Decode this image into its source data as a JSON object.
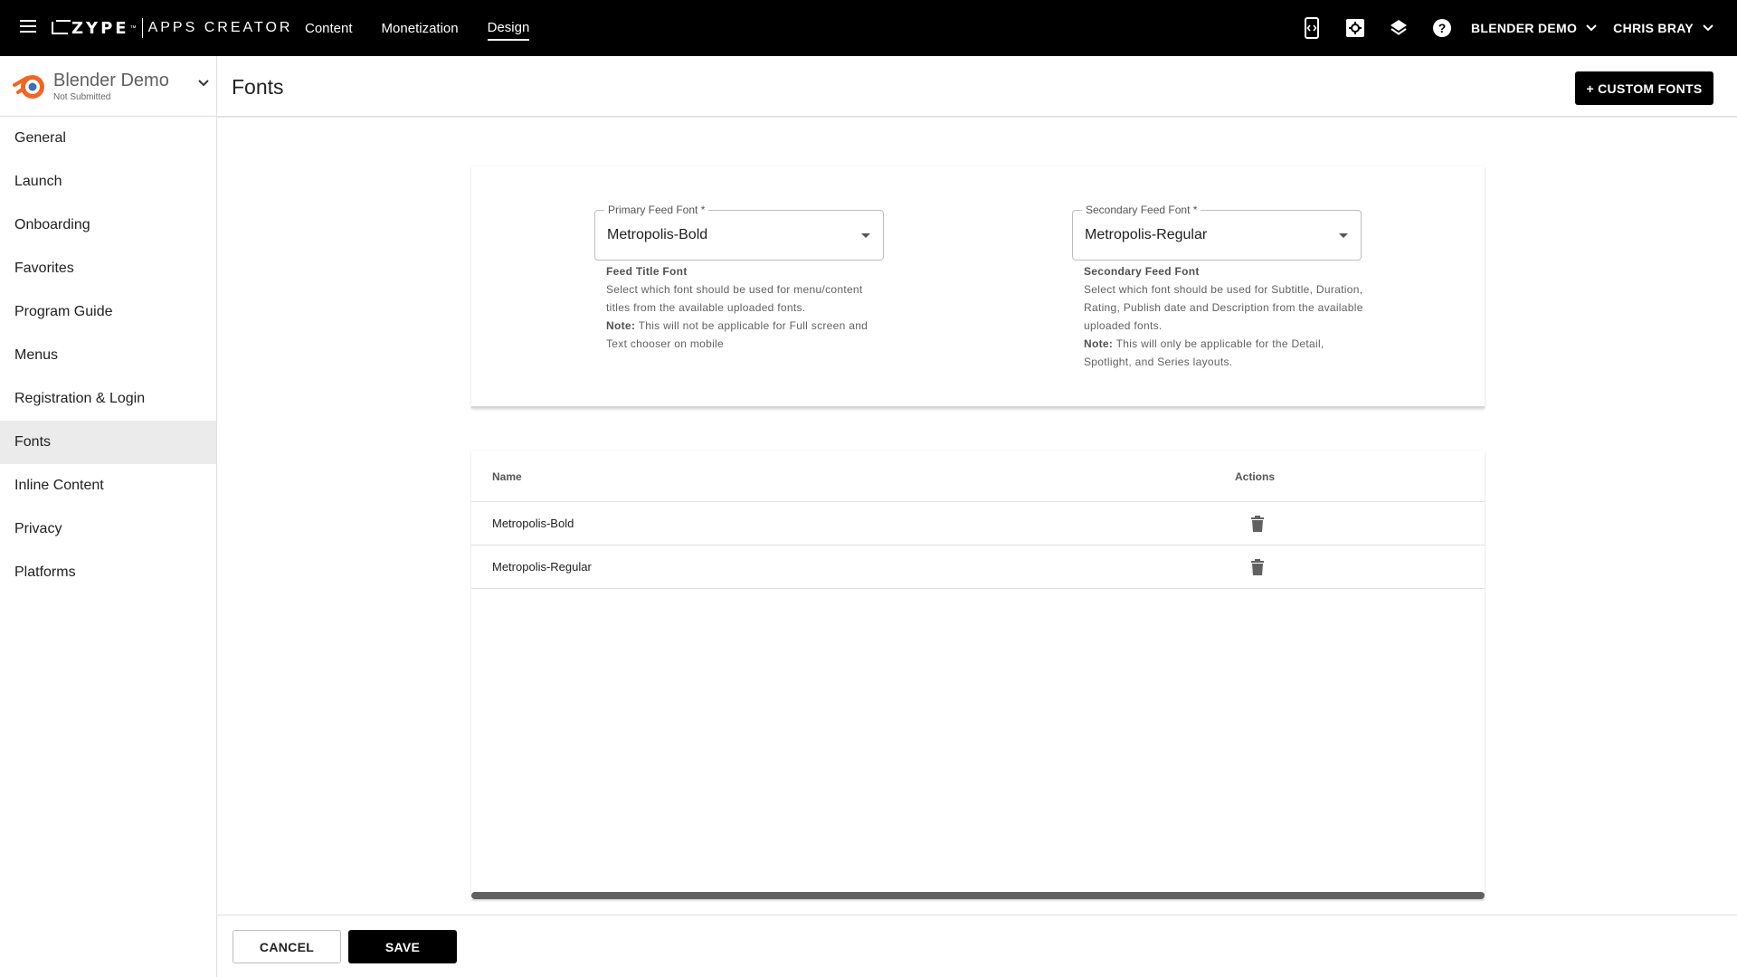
{
  "topbar": {
    "logo_text": "ZYPE",
    "logo_tm": "™",
    "app_name": "APPS CREATOR",
    "nav": [
      {
        "label": "Content"
      },
      {
        "label": "Monetization"
      },
      {
        "label": "Design",
        "active": true
      }
    ],
    "icons": [
      "preview-code-icon",
      "settings-square-icon",
      "layers-icon",
      "help-icon"
    ],
    "workspace": "BLENDER DEMO",
    "user": "CHRIS BRAY"
  },
  "sidebar": {
    "app_title": "Blender Demo",
    "app_status": "Not Submitted",
    "items": [
      {
        "label": "General"
      },
      {
        "label": "Launch"
      },
      {
        "label": "Onboarding"
      },
      {
        "label": "Favorites"
      },
      {
        "label": "Program Guide"
      },
      {
        "label": "Menus"
      },
      {
        "label": "Registration & Login"
      },
      {
        "label": "Fonts",
        "active": true
      },
      {
        "label": "Inline Content"
      },
      {
        "label": "Privacy"
      },
      {
        "label": "Platforms"
      }
    ]
  },
  "page": {
    "title": "Fonts",
    "custom_fonts_button": "+ CUSTOM FONTS"
  },
  "feed_fonts": {
    "primary": {
      "label": "Primary Feed Font *",
      "value": "Metropolis-Bold",
      "help_title": "Feed Title Font",
      "help_text": "Select which font should be used for menu/content titles from the available uploaded fonts.",
      "note_label": "Note:",
      "note_text": "This will not be applicable for Full screen and Text chooser on mobile"
    },
    "secondary": {
      "label": "Secondary Feed Font *",
      "value": "Metropolis-Regular",
      "help_title": "Secondary Feed Font",
      "help_text": "Select which font should be used for Subtitle, Duration, Rating, Publish date and Description from the available uploaded fonts.",
      "note_label": "Note:",
      "note_text": "This will only be applicable for the Detail, Spotlight, and Series layouts."
    }
  },
  "fonts_table": {
    "columns": {
      "name": "Name",
      "actions": "Actions"
    },
    "rows": [
      {
        "name": "Metropolis-Bold"
      },
      {
        "name": "Metropolis-Regular"
      }
    ]
  },
  "footer": {
    "cancel": "CANCEL",
    "save": "SAVE"
  },
  "colors": {
    "topbar_bg": "#000000",
    "primary_button": "#000000",
    "active_nav_bg": "#ebebeb",
    "brand_orange": "#f26522"
  }
}
